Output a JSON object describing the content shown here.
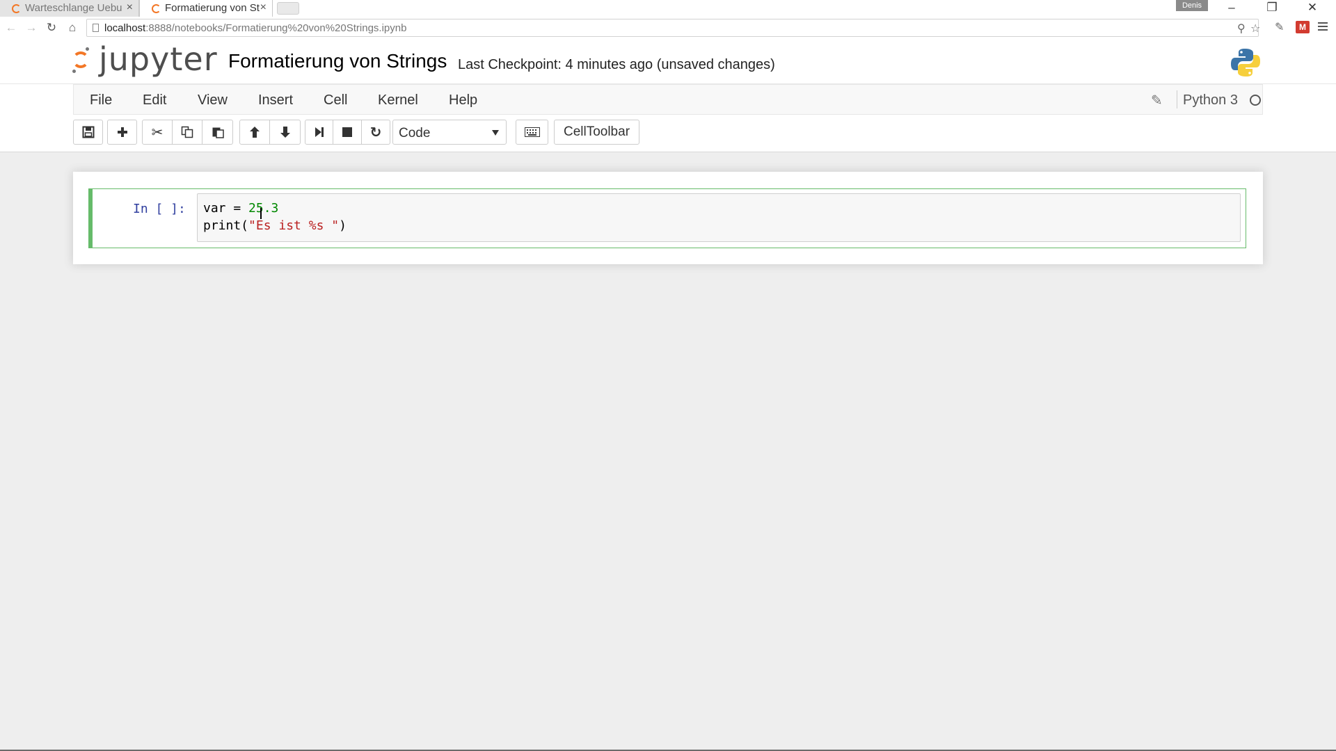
{
  "browser": {
    "tabs": [
      {
        "title": "Warteschlange Uebu",
        "active": false
      },
      {
        "title": "Formatierung von St",
        "active": true
      }
    ],
    "profile_name": "Denis",
    "url": {
      "host": "localhost",
      "path": ":8888/notebooks/Formatierung%20von%20Strings.ipynb"
    }
  },
  "jupyter": {
    "logo_text": "jupyter",
    "notebook_title": "Formatierung von Strings",
    "checkpoint": "Last Checkpoint: 4 minutes ago (unsaved changes)",
    "menu": [
      "File",
      "Edit",
      "View",
      "Insert",
      "Cell",
      "Kernel",
      "Help"
    ],
    "kernel_name": "Python 3",
    "toolbar": {
      "cell_type": "Code",
      "celltoolbar_label": "CellToolbar"
    }
  },
  "cells": [
    {
      "prompt": "In [ ]:",
      "lines": [
        {
          "code_var": "var",
          "code_op": " = ",
          "code_num": "25.3"
        },
        {
          "code_fn": "print(",
          "code_str": "\"Es ist %s \"",
          "code_close": ")"
        }
      ]
    }
  ],
  "colors": {
    "jupyter_orange": "#f37726",
    "edit_mode_green": "#66bb6a",
    "prompt_blue": "#303f9f",
    "string_red": "#ba2121",
    "number_green": "#008800"
  }
}
